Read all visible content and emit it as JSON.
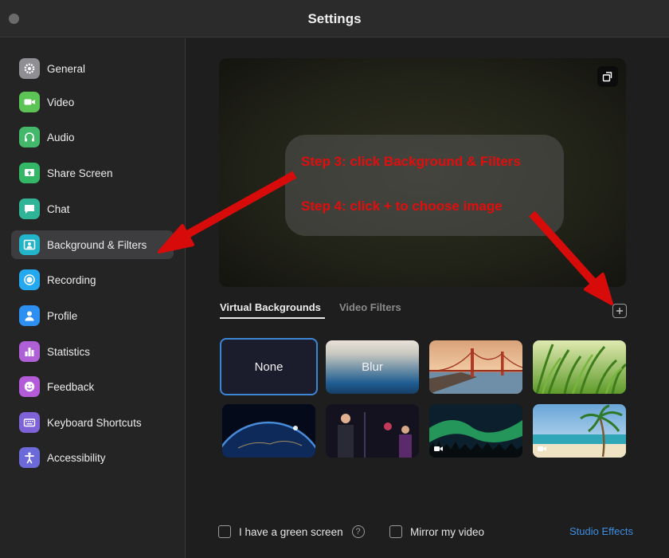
{
  "window": {
    "title": "Settings"
  },
  "sidebar": {
    "items": [
      {
        "label": "General",
        "icon": "gear-icon",
        "color": "#8e8e93"
      },
      {
        "label": "Video",
        "icon": "video-camera-icon",
        "color": "#5cc455"
      },
      {
        "label": "Audio",
        "icon": "headphones-icon",
        "color": "#43b86b"
      },
      {
        "label": "Share Screen",
        "icon": "share-screen-icon",
        "color": "#33b766"
      },
      {
        "label": "Chat",
        "icon": "chat-bubble-icon",
        "color": "#2fb497"
      },
      {
        "label": "Background & Filters",
        "icon": "person-frame-icon",
        "color": "#22b5c9",
        "active": true
      },
      {
        "label": "Recording",
        "icon": "record-icon",
        "color": "#24a8f0"
      },
      {
        "label": "Profile",
        "icon": "profile-icon",
        "color": "#2e8ff2"
      },
      {
        "label": "Statistics",
        "icon": "bar-chart-icon",
        "color": "#b060d6"
      },
      {
        "label": "Feedback",
        "icon": "smiley-icon",
        "color": "#b45bd9"
      },
      {
        "label": "Keyboard Shortcuts",
        "icon": "keyboard-icon",
        "color": "#7d62d8"
      },
      {
        "label": "Accessibility",
        "icon": "accessibility-icon",
        "color": "#6c6ad8"
      }
    ]
  },
  "annotations": {
    "step3": "Step 3: click Background & Filters",
    "step4": "Step 4: click + to choose image",
    "color": "#e30d0d"
  },
  "tabs": [
    {
      "label": "Virtual Backgrounds",
      "active": true
    },
    {
      "label": "Video Filters",
      "active": false
    }
  ],
  "backgrounds": [
    {
      "label": "None",
      "kind": "none",
      "selected": true
    },
    {
      "label": "Blur",
      "kind": "blur"
    },
    {
      "label": "",
      "kind": "golden-gate-image"
    },
    {
      "label": "",
      "kind": "grass-image"
    },
    {
      "label": "",
      "kind": "earth-from-space-image"
    },
    {
      "label": "",
      "kind": "people-on-stage-image"
    },
    {
      "label": "",
      "kind": "aurora-video",
      "video": true
    },
    {
      "label": "",
      "kind": "beach-video",
      "video": true
    }
  ],
  "options": {
    "green_screen": "I have a green screen",
    "help": "?",
    "mirror": "Mirror my video",
    "studio_effects": "Studio Effects"
  },
  "colors": {
    "accent": "#3d8de0",
    "selection": "#3c86d6"
  }
}
